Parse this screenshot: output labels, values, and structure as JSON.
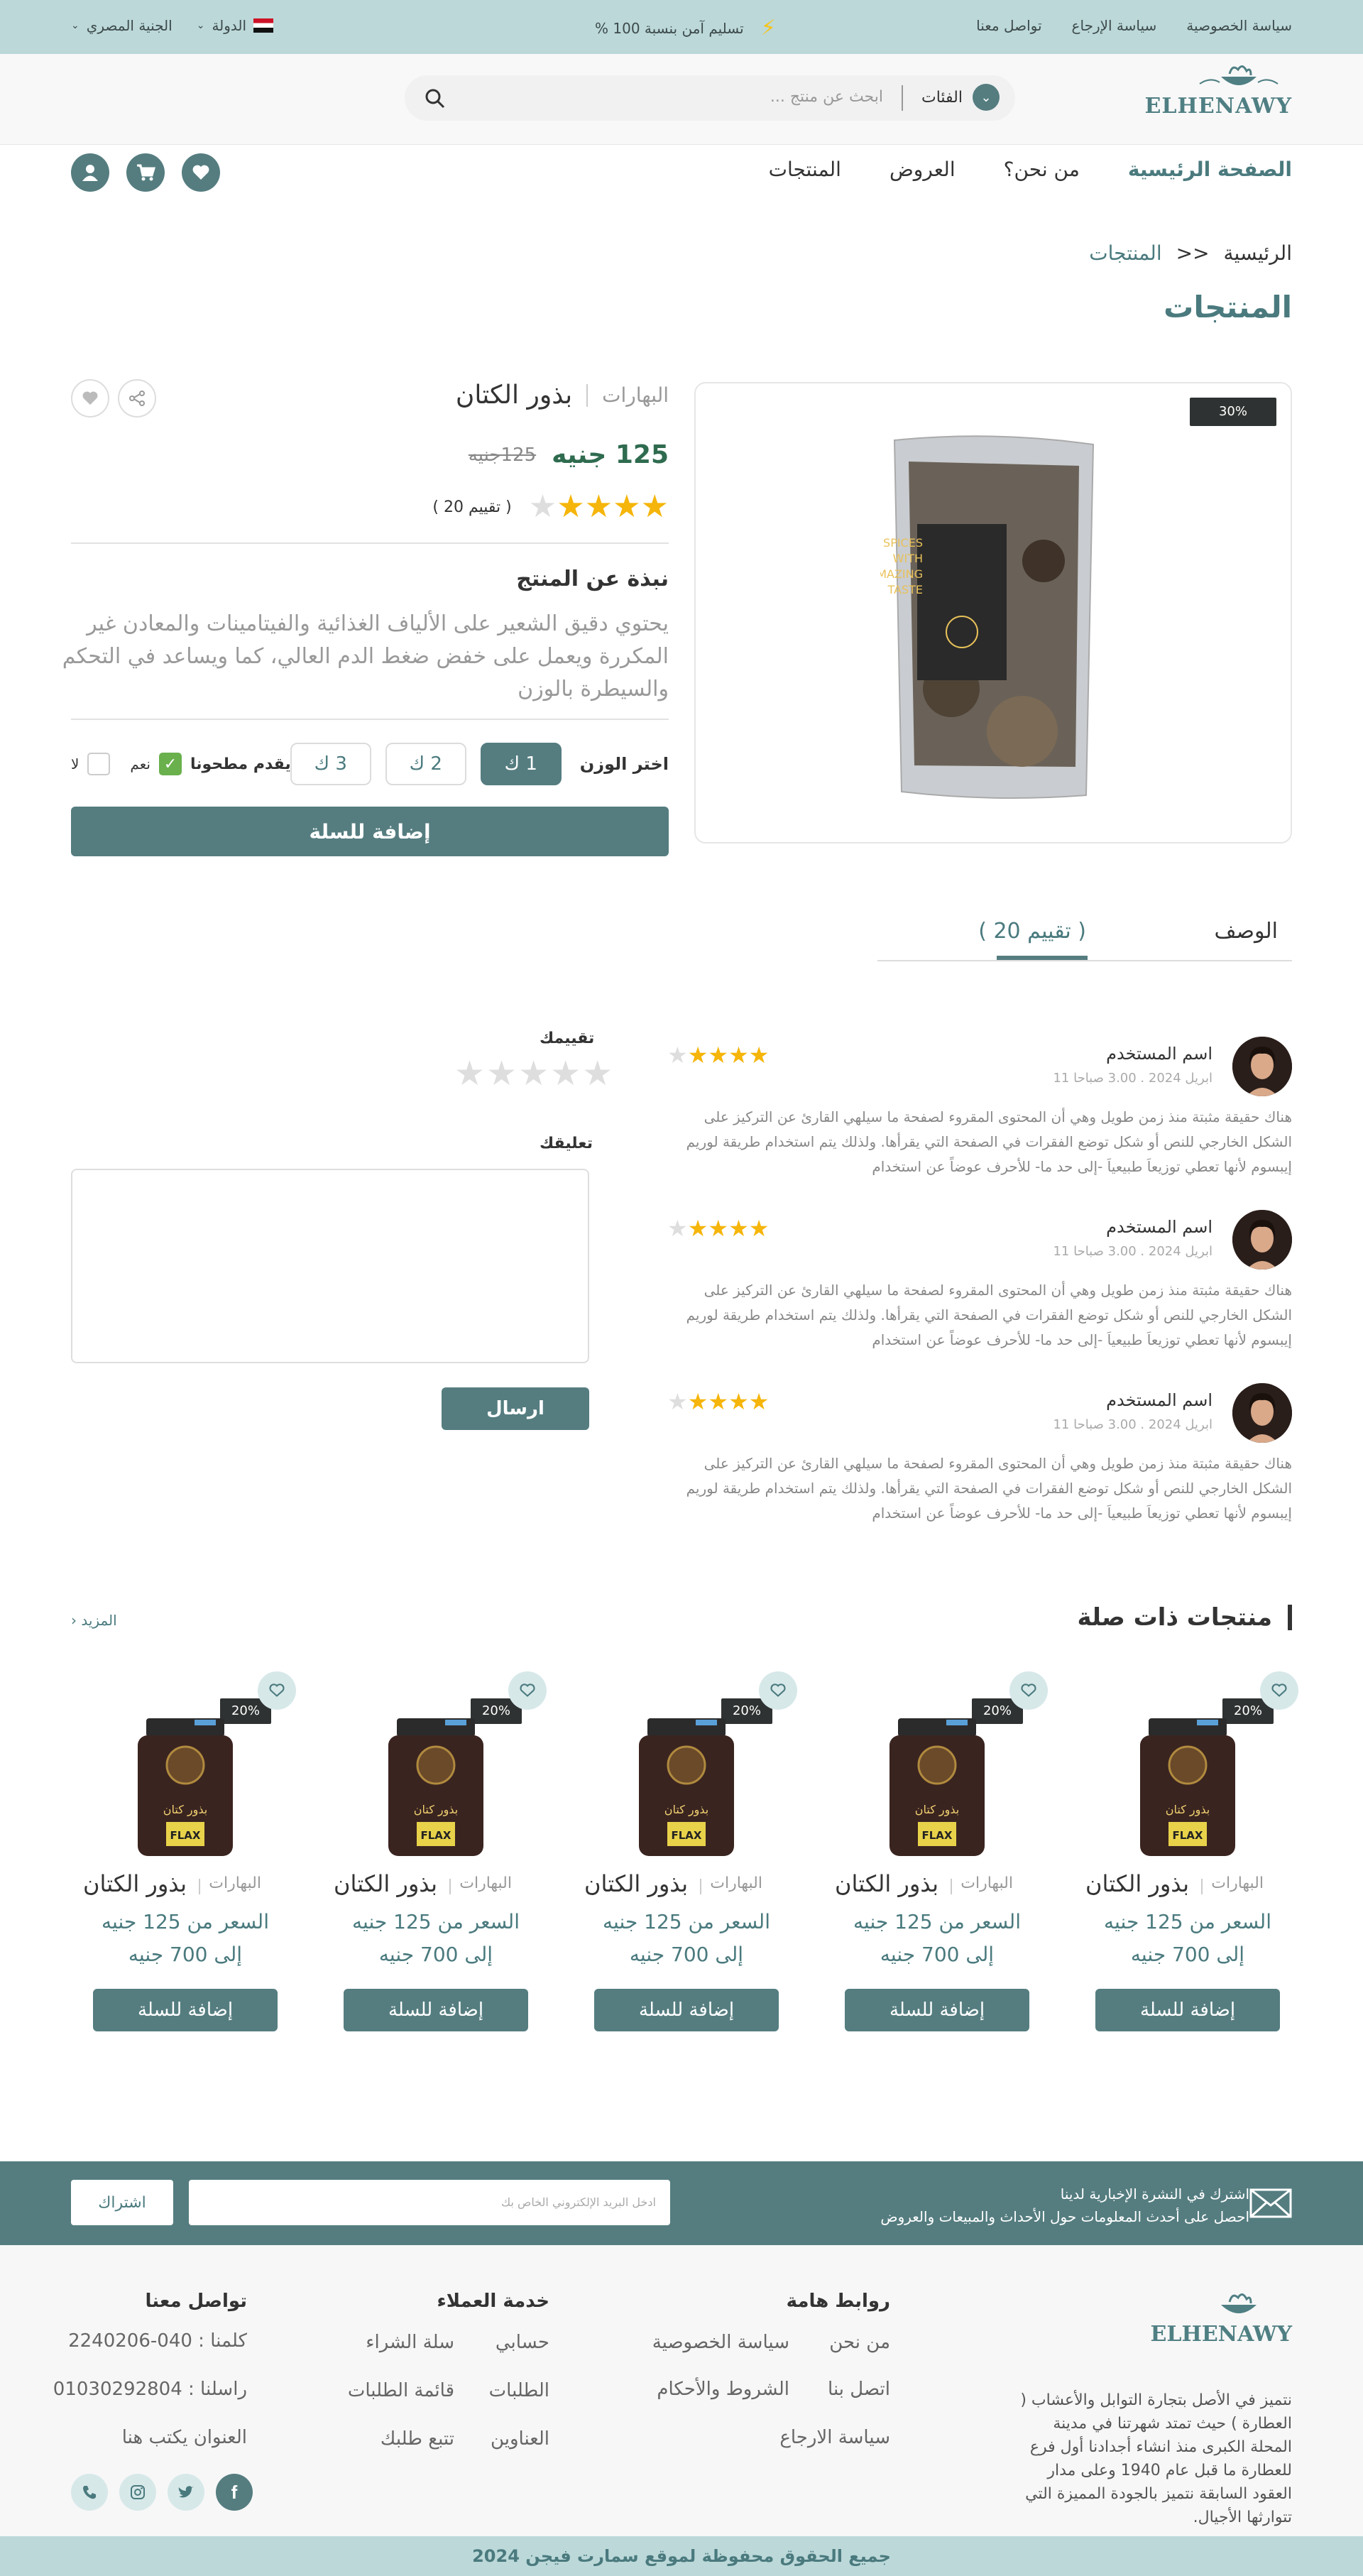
{
  "topbar": {
    "links": [
      "سياسة الخصوصية",
      "سياسة الإرجاع",
      "تواصل معنا"
    ],
    "shipping": "تسليم آمن بنسبة 100 %",
    "country_label": "الدولة",
    "currency_label": "الجنية المصري"
  },
  "header": {
    "logo_text": "ELHENAWY",
    "categories_label": "الفئات",
    "search_placeholder": "ابحث عن منتج ..."
  },
  "nav": [
    "الصفحة الرئيسية",
    "من نحن؟",
    "العروض",
    "المنتجات"
  ],
  "breadcrumb": {
    "home": "الرئيسية",
    "sep": ">>",
    "current": "المنتجات"
  },
  "page_title": "المنتجات",
  "product": {
    "discount": "30%",
    "category": "البهارات",
    "name": "بذور الكتان",
    "price_new": "125 جنيه",
    "price_old": "125جنيه",
    "rating": 4,
    "rating_count": "( تقييم 20 )",
    "about_title": "نبذة عن المنتج",
    "about_text": "يحتوي دقيق الشعير على الألياف الغذائية والفيتامينات والمعادن غير المكررة ويعمل على خفض ضغط الدم العالي، كما ويساعد في التحكم والسيطرة بالوزن",
    "weight_label": "اختر الوزن",
    "weights": [
      "1 ك",
      "2 ك",
      "3 ك"
    ],
    "selected_weight": "1 ك",
    "milled_label": "يقدم مطحونا",
    "yes": "نعم",
    "no": "لا",
    "add_to_cart": "إضافة للسلة",
    "pack_text": "SPICES WITH AMAZING TASTE"
  },
  "tabs": {
    "description": "الوصف",
    "reviews": "( تقييم 20 )"
  },
  "reviews": [
    {
      "name": "اسم المستخدم",
      "date": "ابريل 2024 . 3.00 صباحا 11",
      "stars": 4,
      "text": "هناك حقيقة مثبتة منذ زمن طويل وهي أن المحتوى المقروء لصفحة ما سيلهي القارئ عن التركيز على الشكل الخارجي للنص أو شكل توضع الفقرات في الصفحة التي يقرأها. ولذلك يتم استخدام طريقة لوريم إيبسوم لأنها تعطي توزيعاَ طبيعياَ -إلى حد ما- للأحرف عوضاً عن استخدام"
    },
    {
      "name": "اسم المستخدم",
      "date": "ابريل 2024 . 3.00 صباحا 11",
      "stars": 4,
      "text": "هناك حقيقة مثبتة منذ زمن طويل وهي أن المحتوى المقروء لصفحة ما سيلهي القارئ عن التركيز على الشكل الخارجي للنص أو شكل توضع الفقرات في الصفحة التي يقرأها. ولذلك يتم استخدام طريقة لوريم إيبسوم لأنها تعطي توزيعاَ طبيعياَ -إلى حد ما- للأحرف عوضاً عن استخدام"
    },
    {
      "name": "اسم المستخدم",
      "date": "ابريل 2024 . 3.00 صباحا 11",
      "stars": 4,
      "text": "هناك حقيقة مثبتة منذ زمن طويل وهي أن المحتوى المقروء لصفحة ما سيلهي القارئ عن التركيز على الشكل الخارجي للنص أو شكل توضع الفقرات في الصفحة التي يقرأها. ولذلك يتم استخدام طريقة لوريم إيبسوم لأنها تعطي توزيعاَ طبيعياَ -إلى حد ما- للأحرف عوضاً عن استخدام"
    }
  ],
  "review_form": {
    "rating_label": "تقييمك",
    "comment_label": "تعليقك",
    "send": "ارسال"
  },
  "related": {
    "title": "منتجات ذات صلة",
    "more": "المزيد",
    "cards": [
      {
        "discount": "20%",
        "category": "البهارات",
        "name": "بذور الكتان",
        "price_from": "السعر من  125 جنيه",
        "price_to": "إلى 700 جنيه",
        "add": "إضافة للسلة",
        "jar_label": "بذور كتان",
        "jar_label2": "FLAX"
      },
      {
        "discount": "20%",
        "category": "البهارات",
        "name": "بذور الكتان",
        "price_from": "السعر من  125 جنيه",
        "price_to": "إلى 700 جنيه",
        "add": "إضافة للسلة",
        "jar_label": "بذور كتان",
        "jar_label2": "FLAX"
      },
      {
        "discount": "20%",
        "category": "البهارات",
        "name": "بذور الكتان",
        "price_from": "السعر من  125 جنيه",
        "price_to": "إلى 700 جنيه",
        "add": "إضافة للسلة",
        "jar_label": "بذور كتان",
        "jar_label2": "FLAX"
      },
      {
        "discount": "20%",
        "category": "البهارات",
        "name": "بذور الكتان",
        "price_from": "السعر من  125 جنيه",
        "price_to": "إلى 700 جنيه",
        "add": "إضافة للسلة",
        "jar_label": "بذور كتان",
        "jar_label2": "FLAX"
      },
      {
        "discount": "20%",
        "category": "البهارات",
        "name": "بذور الكتان",
        "price_from": "السعر من  125 جنيه",
        "price_to": "إلى 700 جنيه",
        "add": "إضافة للسلة",
        "jar_label": "بذور كتان",
        "jar_label2": "FLAX"
      }
    ]
  },
  "newsletter": {
    "line1": "اشترك في النشرة الإخبارية لدينا",
    "line2": "احصل على أحدث المعلومات حول الأحداث والمبيعات والعروض",
    "placeholder": "ادخل البريد الإلكتروني الخاص بك",
    "button": "اشتراك"
  },
  "footer": {
    "about": "نتميز في الأصل بتجارة التوابل والأعشاب ( العطارة ) حيث تمتد شهرتنا في مدينة المحلة الكبرى منذ انشاء أجدادنا أول فرع للعطارة ما قبل عام 1940 وعلى مدار العقود السابقة نتميز بالجودة المميزة التي تتوارثها الأجيال.",
    "important_links": {
      "title": "روابط هامة",
      "items": [
        "من نحن",
        "سياسة الخصوصية",
        "اتصل بنا",
        "الشروط والأحكام",
        "سياسة الارجاع"
      ]
    },
    "customer_service": {
      "title": "خدمة العملاء",
      "items": [
        "حسابي",
        "سلة الشراء",
        "الطلبات",
        "قائمة الطلبات",
        "العناوين",
        "تتبع طلبك"
      ]
    },
    "contact": {
      "title": "تواصل معنا",
      "items": [
        "كلمنا : 040-2240206",
        "راسلنا : 01030292804",
        "العنوان يكتب هنا"
      ]
    },
    "copyright": "جميع الحقوق محفوظة لموقع سمارت فيجن 2024"
  },
  "colors": {
    "accent": "#557d80",
    "topbar": "#bcd8d9",
    "star": "#f5b50a",
    "price": "#2f6b4f"
  }
}
